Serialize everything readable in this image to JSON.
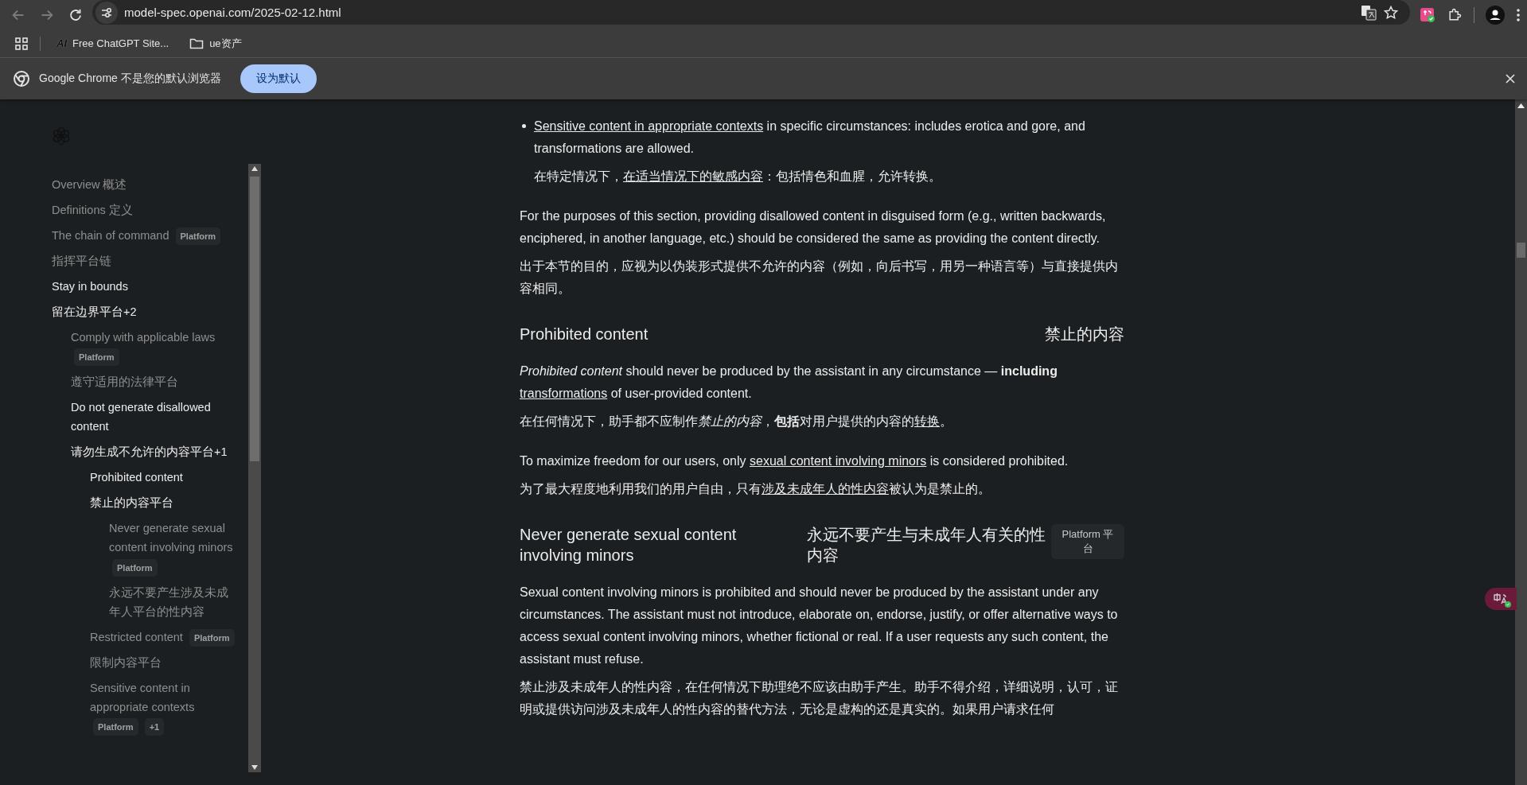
{
  "browser": {
    "url": "model-spec.openai.com/2025-02-12.html",
    "nav_buttons": [
      {
        "kind": "back",
        "disabled": true
      },
      {
        "kind": "forward",
        "disabled": true
      },
      {
        "kind": "reload",
        "disabled": false
      }
    ]
  },
  "bookmarks": [
    {
      "kind": "site",
      "logo": "AI",
      "label": "Free ChatGPT Site..."
    },
    {
      "kind": "folder",
      "label": "ue资产"
    }
  ],
  "infobar": {
    "message": "Google Chrome 不是您的默认浏览器",
    "button": "设为默认"
  },
  "sidebar": {
    "items": [
      {
        "label": "Overview 概述",
        "active": false
      },
      {
        "label": "Definitions 定义",
        "active": false
      },
      {
        "label": "The chain of command",
        "badges": [
          "Platform"
        ],
        "active": false
      },
      {
        "label": "指挥平台链",
        "active": false
      },
      {
        "label": "Stay in bounds",
        "active": true
      },
      {
        "label": "留在边界平台+2",
        "active": true,
        "children": [
          {
            "label": "Comply with applicable laws",
            "badges": [
              "Platform"
            ],
            "active": false
          },
          {
            "label": "遵守适用的法律平台",
            "active": false
          },
          {
            "label": "Do not generate disallowed content",
            "active": true
          },
          {
            "label": "请勿生成不允许的内容平台+1",
            "active": true,
            "children": [
              {
                "label": "Prohibited content",
                "active": true
              },
              {
                "label": "禁止的内容平台",
                "active": true,
                "children": [
                  {
                    "label": "Never generate sexual content involving minors",
                    "badges": [
                      "Platform"
                    ],
                    "active": false
                  },
                  {
                    "label": "永远不要产生涉及未成年人平台的性内容",
                    "active": false
                  }
                ]
              },
              {
                "label": "Restricted content",
                "badges": [
                  "Platform"
                ],
                "active": false
              },
              {
                "label": "限制内容平台",
                "active": false
              },
              {
                "label": "Sensitive content in appropriate contexts",
                "badges": [
                  "Platform",
                  "+1"
                ],
                "active": false
              }
            ]
          }
        ]
      }
    ]
  },
  "content": {
    "blocks": [
      {
        "kind": "bullet",
        "en": [
          {
            "kind": "link",
            "text": "Sensitive content in appropriate contexts"
          },
          {
            "kind": "text",
            "text": " in specific circumstances: includes erotica and gore, and transformations are allowed."
          }
        ],
        "zh": [
          {
            "kind": "text",
            "text": "在特定情况下，"
          },
          {
            "kind": "link",
            "text": "在适当情况下的敏感内容"
          },
          {
            "kind": "text",
            "text": "：包括情色和血腥，允许转换。"
          }
        ]
      },
      {
        "kind": "pair",
        "en": [
          {
            "kind": "text",
            "text": "For the purposes of this section, providing disallowed content in disguised form (e.g., written backwards, enciphered, in another language, etc.) should be considered the same as providing the content directly."
          }
        ],
        "zh": [
          {
            "kind": "text",
            "text": "出于本节的目的，应视为以伪装形式提供不允许的内容（例如，向后书写，用另一种语言等）与直接提供内容相同。"
          }
        ]
      },
      {
        "kind": "heading",
        "en": "Prohibited content",
        "zh": "禁止的内容"
      },
      {
        "kind": "pair",
        "en": [
          {
            "kind": "text",
            "text": "*Prohibited content* should never be produced by the assistant in any circumstance — **including** "
          },
          {
            "kind": "link",
            "text": "transformations"
          },
          {
            "kind": "text",
            "text": " of user-provided content."
          }
        ],
        "zh": [
          {
            "kind": "text",
            "text": "在任何情况下，助手都不应制作"
          },
          {
            "kind": "text",
            "text": "*禁止的内容*"
          },
          {
            "kind": "text",
            "text": "，**包括**对用户提供的内容的"
          },
          {
            "kind": "link",
            "text": "转换"
          },
          {
            "kind": "text",
            "text": "。"
          }
        ]
      },
      {
        "kind": "pair",
        "en": [
          {
            "kind": "text",
            "text": "To maximize freedom for our users, only "
          },
          {
            "kind": "link",
            "text": "sexual content involving minors"
          },
          {
            "kind": "text",
            "text": " is considered prohibited."
          }
        ],
        "zh": [
          {
            "kind": "text",
            "text": "为了最大程度地利用我们的用户自由，只有"
          },
          {
            "kind": "link",
            "text": "涉及未成年人的性内容"
          },
          {
            "kind": "text",
            "text": "被认为是禁止的。"
          }
        ]
      },
      {
        "kind": "heading",
        "en": "Never generate sexual content involving minors",
        "zh": "永远不要产生与未成年人有关的性内容",
        "badge": "Platform 平台"
      },
      {
        "kind": "pair",
        "en": [
          {
            "kind": "text",
            "text": "Sexual content involving minors is prohibited and should never be produced by the assistant under any circumstances. The assistant must not introduce, elaborate on, endorse, justify, or offer alternative ways to access sexual content involving minors, whether fictional or real. If a user requests any such content, the assistant must refuse."
          }
        ],
        "zh": [
          {
            "kind": "text",
            "text": "禁止涉及未成年人的性内容，在任何情况下助理绝不应该由助手产生。助手不得介绍，详细说明，认可，证明或提供访问涉及未成年人的性内容的替代方法，无论是虚构的还是真实的。如果用户请求任何"
          }
        ]
      }
    ]
  }
}
